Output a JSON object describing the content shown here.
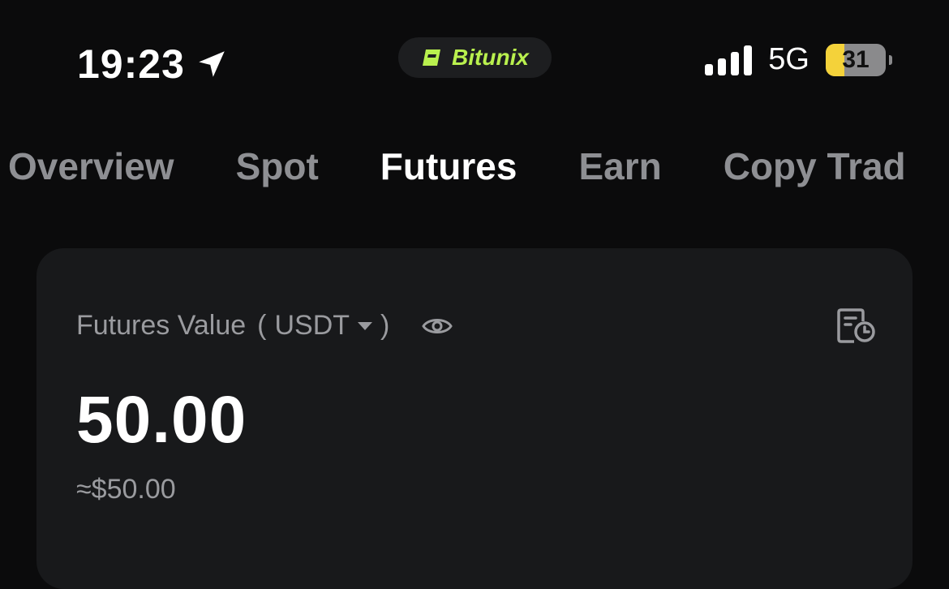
{
  "status_bar": {
    "time": "19:23",
    "network": "5G",
    "battery_level": "31",
    "icons": [
      "location-arrow-icon",
      "signal-bars-icon",
      "battery-icon"
    ]
  },
  "brand": {
    "name": "Bitunix",
    "accent_color": "#b9f04e"
  },
  "tabs": [
    {
      "label": "Overview",
      "active": false
    },
    {
      "label": "Spot",
      "active": false
    },
    {
      "label": "Futures",
      "active": true
    },
    {
      "label": "Earn",
      "active": false
    },
    {
      "label": "Copy Trad",
      "active": false
    }
  ],
  "card": {
    "label": "Futures Value",
    "currency_open": "(",
    "currency": "USDT",
    "currency_close": ")",
    "value": "50.00",
    "approx_value": "≈$50.00",
    "icons": [
      "eye-icon",
      "history-icon"
    ]
  }
}
